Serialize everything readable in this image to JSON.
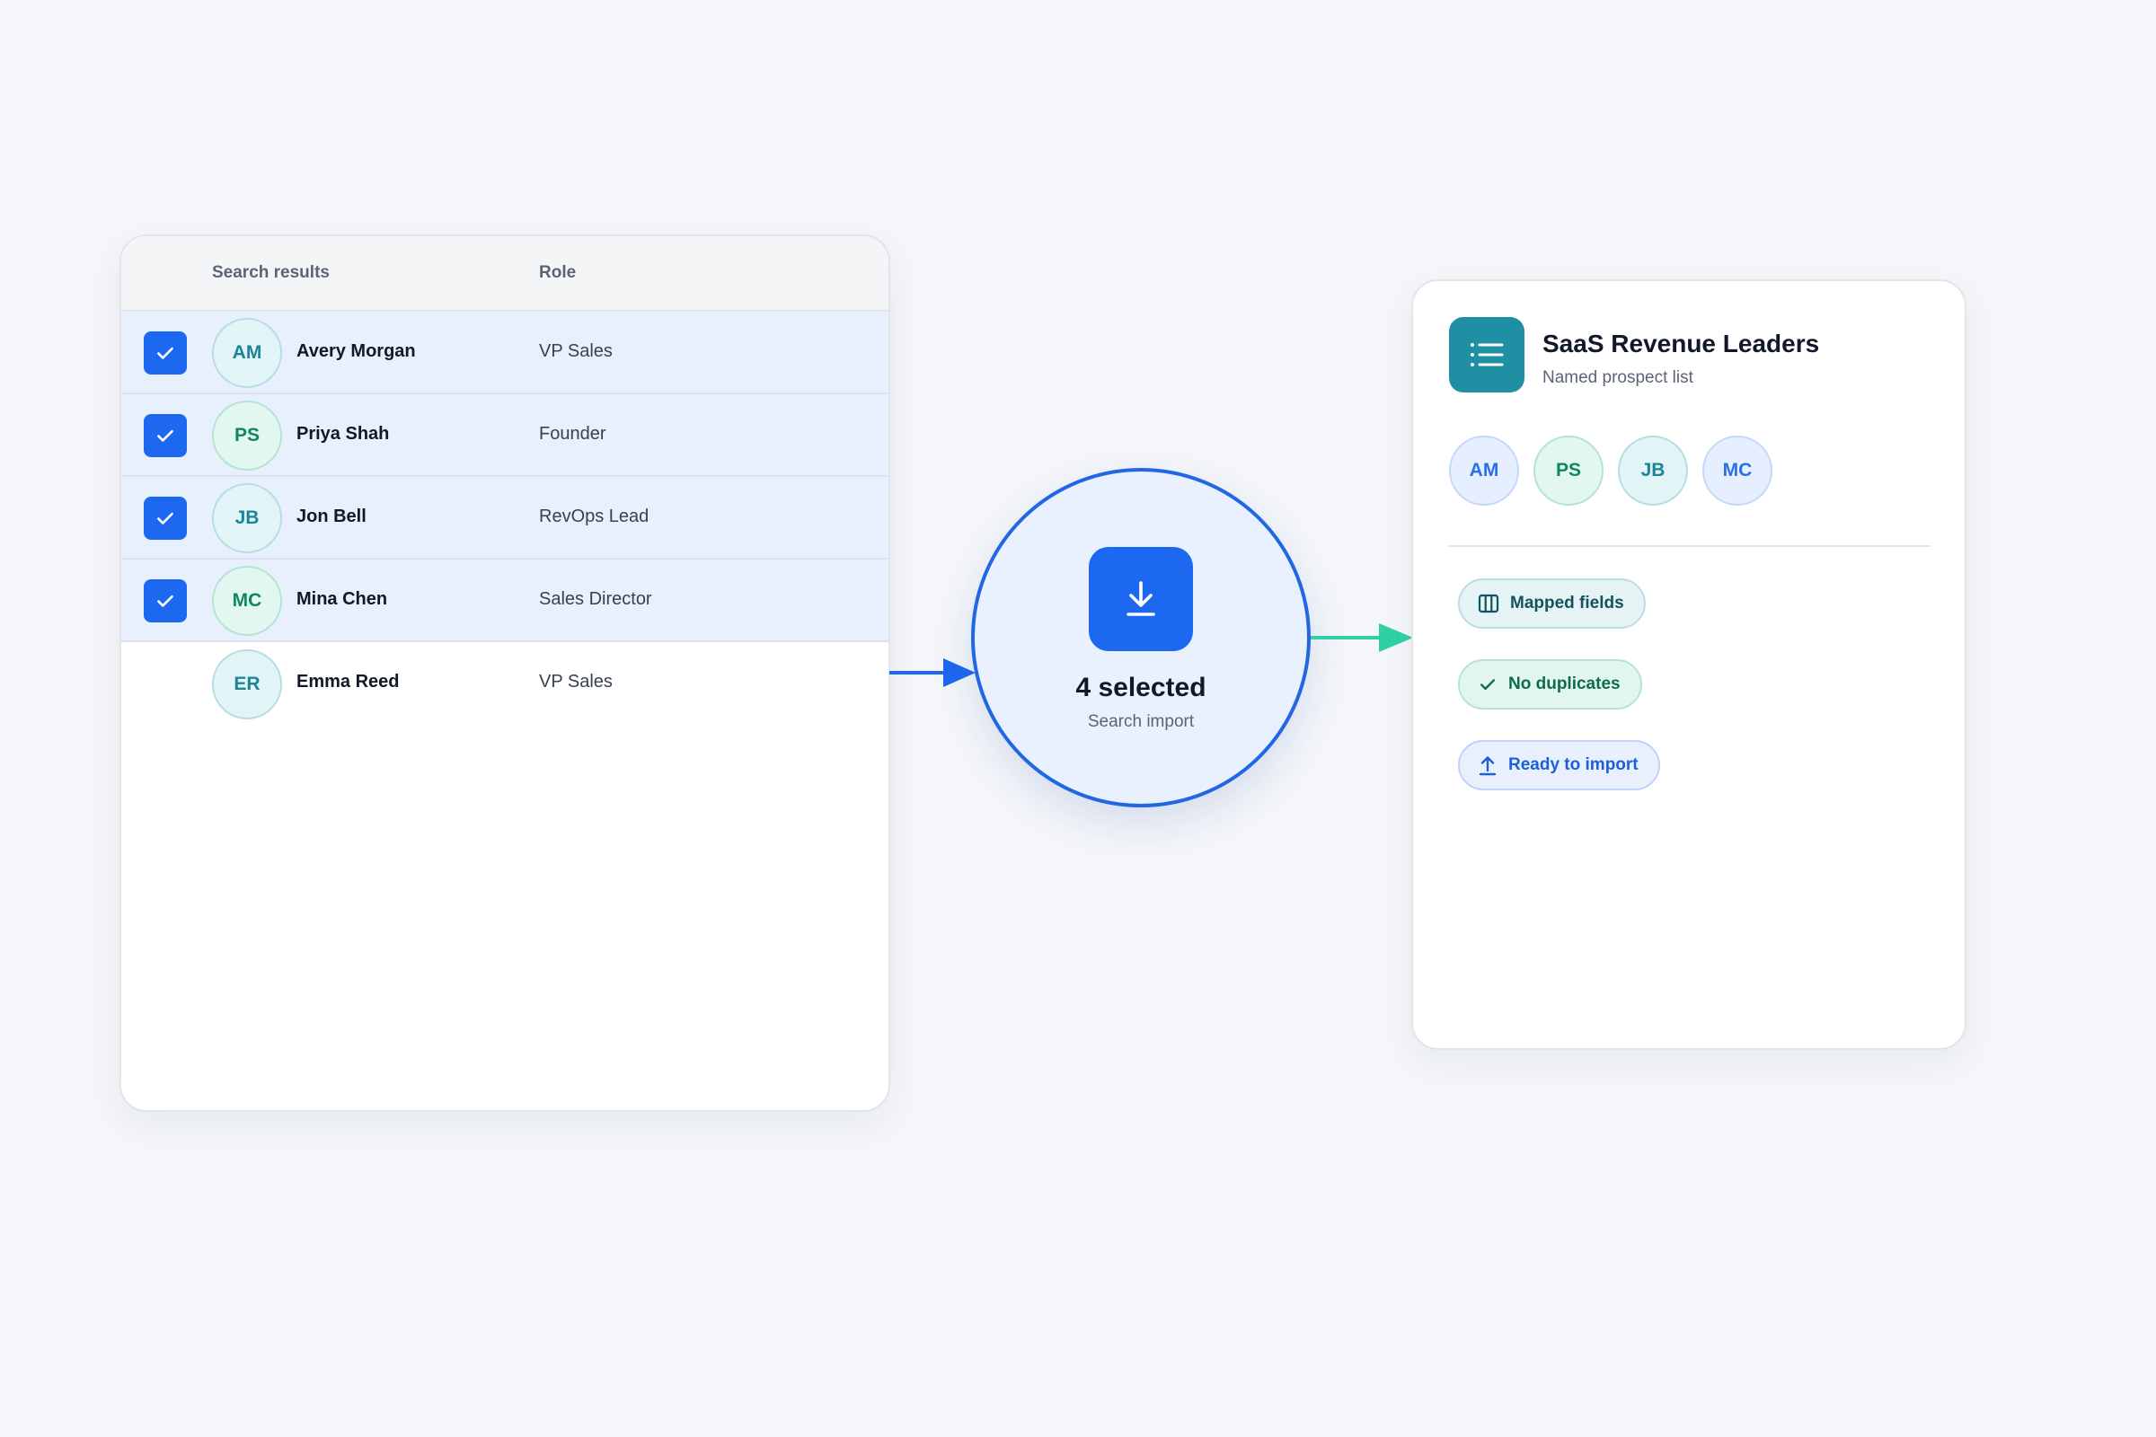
{
  "colors": {
    "accent_blue": "#1d68f0",
    "accent_teal": "#1f8fa3",
    "accent_green": "#2fd1a4",
    "selected_row": "#e8f0fe"
  },
  "results": {
    "columns": {
      "name": "Search results",
      "role": "Role"
    },
    "rows": [
      {
        "initials": "AM",
        "name": "Avery Morgan",
        "role": "VP Sales",
        "selected": true,
        "tone": "teal"
      },
      {
        "initials": "PS",
        "name": "Priya Shah",
        "role": "Founder",
        "selected": true,
        "tone": "green"
      },
      {
        "initials": "JB",
        "name": "Jon Bell",
        "role": "RevOps Lead",
        "selected": true,
        "tone": "teal"
      },
      {
        "initials": "MC",
        "name": "Mina Chen",
        "role": "Sales Director",
        "selected": true,
        "tone": "green"
      },
      {
        "initials": "ER",
        "name": "Emma Reed",
        "role": "VP Sales",
        "selected": false,
        "tone": "teal"
      }
    ]
  },
  "import": {
    "count_label": "4 selected",
    "subtitle": "Search import",
    "icon": "download-icon"
  },
  "list": {
    "icon": "list-icon",
    "title": "SaaS Revenue Leaders",
    "subtitle": "Named prospect list",
    "members": [
      {
        "initials": "AM",
        "tone": "blue"
      },
      {
        "initials": "PS",
        "tone": "green"
      },
      {
        "initials": "JB",
        "tone": "teal"
      },
      {
        "initials": "MC",
        "tone": "blue"
      }
    ],
    "statuses": {
      "mapped": {
        "label": "Mapped fields",
        "icon": "columns-icon"
      },
      "duplicates": {
        "label": "No duplicates",
        "icon": "check-icon"
      },
      "ready": {
        "label": "Ready to import",
        "icon": "upload-icon"
      }
    }
  }
}
